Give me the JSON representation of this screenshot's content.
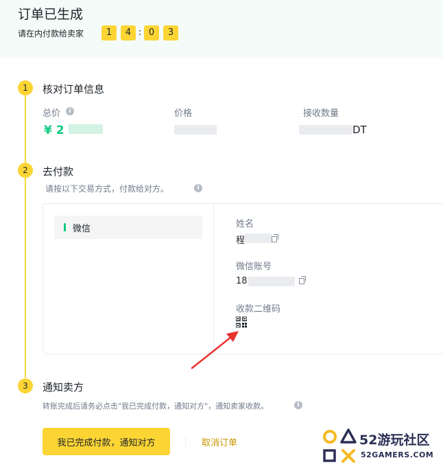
{
  "header": {
    "title": "订单已生成",
    "pay_hint": "请在内付款给卖家",
    "timer": {
      "digits": [
        "1",
        "4",
        "0",
        "3"
      ],
      "separator": ":"
    }
  },
  "step1": {
    "number": "1",
    "title": "核对订单信息",
    "total_label": "总价",
    "total_value_prefix": "¥ 2",
    "price_label": "价格",
    "qty_label": "接收数量",
    "qty_value_suffix": "DT"
  },
  "step2": {
    "number": "2",
    "title": "去付款",
    "hint": "请按以下交易方式，付款给对方。",
    "method": "微信",
    "name_label": "姓名",
    "name_value_prefix": "程",
    "account_label": "微信账号",
    "account_value_prefix": "18",
    "qr_label": "收款二维码"
  },
  "step3": {
    "number": "3",
    "title": "通知卖方",
    "hint": "转账完成后请务必点击\"我已完成付款，通知对方\"，通知卖家收款。"
  },
  "actions": {
    "confirm_label": "我已完成付款，通知对方",
    "cancel_label": "取消订单"
  },
  "watermark": {
    "main": "52游玩社区",
    "sub": "52GAMERS.COM"
  },
  "colors": {
    "accent_yellow": "#fcd535",
    "price_green": "#0ecb81",
    "link_gold": "#c99400",
    "arrow_red": "#e8322e"
  }
}
